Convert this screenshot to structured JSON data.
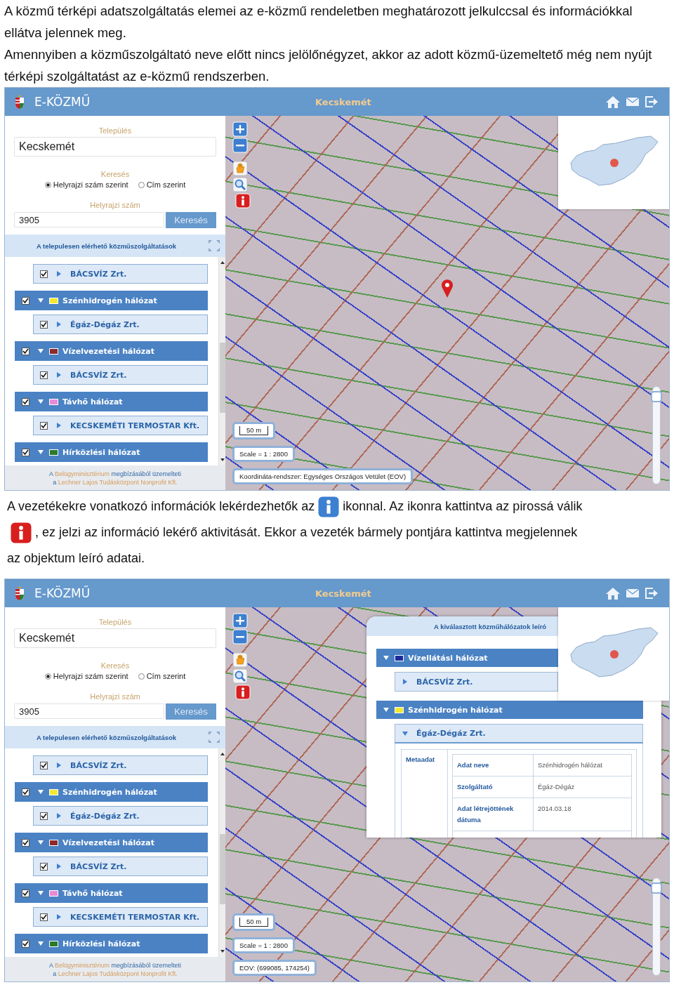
{
  "intro": [
    "A közmű térképi adatszolgáltatás elemei az e-közmű rendeletben meghatározott jelkulccsal és információkkal ellátva jelennek meg.",
    "Amennyiben a közműszolgáltató neve előtt nincs jelölőnégyzet, akkor az adott közmű-üzemeltető még nem nyújt térképi szolgáltatást az e-közmű rendszerben."
  ],
  "screens": [
    {
      "header": {
        "brand": "E-KÖZMŰ",
        "city": "Kecskemét"
      },
      "search": {
        "settlement_label": "Település",
        "settlement": "Kecskemét",
        "mode_label": "Keresés",
        "modes": [
          {
            "label": "Helyrajzi szám szerint",
            "selected": true
          },
          {
            "label": "Cím szerint",
            "selected": false
          }
        ],
        "parcel_label": "Helyrajzi szám",
        "parcel": "3905",
        "button": "Keresés"
      },
      "services": {
        "title": "A telepulesen elérhető közműszolgáltatások",
        "items": [
          {
            "kind": "provider",
            "name": "BÁCSVÍZ Zrt.",
            "checked": true,
            "expanded": false
          },
          {
            "kind": "group",
            "name": "Szénhidrogén hálózat",
            "checked": true,
            "expanded": true,
            "color": "#f2e830",
            "children": [
              {
                "name": "Égáz-Dégáz Zrt.",
                "checked": true,
                "expanded": false
              }
            ]
          },
          {
            "kind": "group",
            "name": "Vízelvezetési hálózat",
            "checked": true,
            "expanded": true,
            "color": "#8b2a2a",
            "children": [
              {
                "name": "BÁCSVÍZ Zrt.",
                "checked": true,
                "expanded": false
              }
            ]
          },
          {
            "kind": "group",
            "name": "Távhő hálózat",
            "checked": true,
            "expanded": true,
            "color": "#e88ad8",
            "children": [
              {
                "name": "KECSKEMÉTI TERMOSTAR Kft.",
                "checked": true,
                "expanded": false
              }
            ]
          },
          {
            "kind": "group",
            "name": "Hírközlési hálózat",
            "checked": true,
            "expanded": true,
            "color": "#2a7a2a"
          }
        ]
      },
      "footer": [
        [
          {
            "kind": "text",
            "text": "A "
          },
          {
            "kind": "link",
            "text": "Belügyminisztérium"
          },
          {
            "kind": "text",
            "text": " megbízásából üzemelteti"
          }
        ],
        [
          {
            "kind": "text",
            "text": "a "
          },
          {
            "kind": "link",
            "text": "Lechner Lajos Tudásközpont Nonprofit Kft."
          }
        ]
      ],
      "map": {
        "tools": [
          {
            "kind": "zoom_in"
          },
          {
            "kind": "zoom_out"
          },
          {
            "kind": "pan"
          },
          {
            "kind": "zoom_box"
          },
          {
            "kind": "info",
            "active": true
          }
        ],
        "scale_bar": "50 m",
        "scale": "Scale = 1 : 2800",
        "coordinates": "Koordináta-rendszer: Egységes Országos Vetület (EOV)",
        "pin": true,
        "zoom_slider": {
          "level": 0.95
        }
      }
    },
    {
      "header": {
        "brand": "E-KÖZMŰ",
        "city": "Kecskemét"
      },
      "search": {
        "settlement_label": "Település",
        "settlement": "Kecskemét",
        "mode_label": "Keresés",
        "modes": [
          {
            "label": "Helyrajzi szám szerint",
            "selected": true
          },
          {
            "label": "Cím szerint",
            "selected": false
          }
        ],
        "parcel_label": "Helyrajzi szám",
        "parcel": "3905",
        "button": "Keresés"
      },
      "services": {
        "title": "A telepulesen elérhető közműszolgáltatások",
        "items": [
          {
            "kind": "provider",
            "name": "BÁCSVÍZ Zrt.",
            "checked": true,
            "expanded": false
          },
          {
            "kind": "group",
            "name": "Szénhidrogén hálózat",
            "checked": true,
            "expanded": true,
            "color": "#f2e830",
            "children": [
              {
                "name": "Égáz-Dégáz Zrt.",
                "checked": true,
                "expanded": false
              }
            ]
          },
          {
            "kind": "group",
            "name": "Vízelvezetési hálózat",
            "checked": true,
            "expanded": true,
            "color": "#8b2a2a",
            "children": [
              {
                "name": "BÁCSVÍZ Zrt.",
                "checked": true,
                "expanded": false
              }
            ]
          },
          {
            "kind": "group",
            "name": "Távhő hálózat",
            "checked": true,
            "expanded": true,
            "color": "#e88ad8",
            "children": [
              {
                "name": "KECSKEMÉTI TERMOSTAR Kft.",
                "checked": true,
                "expanded": false
              }
            ]
          },
          {
            "kind": "group",
            "name": "Hírközlési hálózat",
            "checked": true,
            "expanded": true,
            "color": "#2a7a2a"
          }
        ]
      },
      "footer": [
        [
          {
            "kind": "text",
            "text": "A "
          },
          {
            "kind": "link",
            "text": "Belügyminisztérium"
          },
          {
            "kind": "text",
            "text": " megbízásából üzemelteti"
          }
        ],
        [
          {
            "kind": "text",
            "text": "a "
          },
          {
            "kind": "link",
            "text": "Lechner Lajos Tudásközpont Nonprofit Kft."
          }
        ]
      ],
      "map": {
        "tools": [
          {
            "kind": "zoom_in"
          },
          {
            "kind": "zoom_out"
          },
          {
            "kind": "pan"
          },
          {
            "kind": "zoom_box"
          },
          {
            "kind": "info",
            "active": true
          }
        ],
        "scale_bar": "50 m",
        "scale": "Scale = 1 : 2800",
        "coordinates": "EOV: (699085, 174254)",
        "pin": false,
        "zoom_slider": {
          "level": 0.95
        },
        "popup": {
          "title": "A kiválasztott közműhálózatok leíró",
          "groups": [
            {
              "name": "Vízellátási hálózat",
              "color": "#1c2a9c",
              "expanded": true,
              "children": [
                {
                  "name": "BÁCSVÍZ Zrt.",
                  "expanded": false
                }
              ]
            },
            {
              "name": "Szénhidrogén hálózat",
              "color": "#f2e830",
              "expanded": true,
              "children": [
                {
                  "name": "Égáz-Dégáz Zrt.",
                  "expanded": true,
                  "details": {
                    "label": "Metaadat",
                    "rows": [
                      {
                        "key": "Adat neve",
                        "value": "Szénhidrogén hálózat"
                      },
                      {
                        "key": "Szolgáltató",
                        "value": "Égáz-Dégáz"
                      },
                      {
                        "key": "Adat létrejöttének dátuma",
                        "value": "2014.03.18"
                      }
                    ]
                  }
                }
              ]
            }
          ]
        }
      }
    }
  ],
  "middle": [
    [
      {
        "kind": "text",
        "text": "A vezetékekre vonatkozó információk lekérdezhetők az"
      },
      {
        "kind": "icon",
        "active": false
      },
      {
        "kind": "text",
        "text": "ikonnal. Az ikonra kattintva az pirossá válik"
      }
    ],
    [
      {
        "kind": "icon",
        "active": true
      },
      {
        "kind": "text",
        "text": ", ez jelzi az információ lekérő aktivitását. Ekkor a vezeték bármely pontjára kattintva megjelennek"
      }
    ],
    [
      {
        "kind": "text",
        "text": "az objektum leíró adatai."
      }
    ]
  ]
}
